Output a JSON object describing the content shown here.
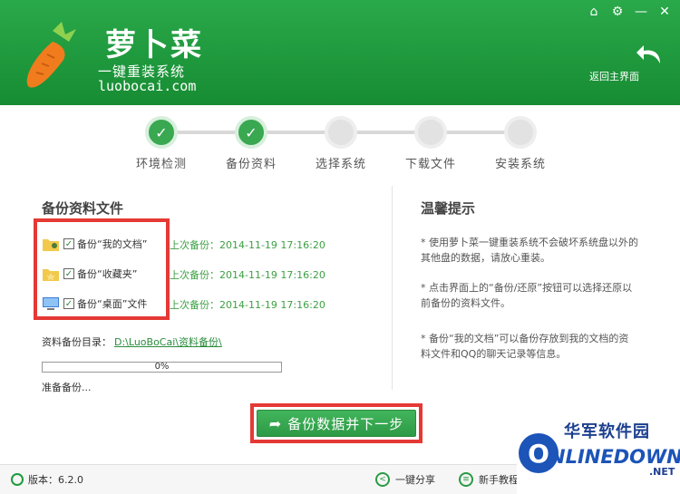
{
  "header": {
    "logo_title": "萝卜菜",
    "logo_subtitle": "一键重装系统",
    "logo_url": "luobocai.com",
    "back_label": "返回主界面",
    "window_buttons": [
      "home-icon",
      "gear-icon",
      "minimize-icon",
      "close-icon"
    ]
  },
  "steps": [
    {
      "label": "环境检测",
      "done": true
    },
    {
      "label": "备份资料",
      "done": true
    },
    {
      "label": "选择系统",
      "done": false
    },
    {
      "label": "下载文件",
      "done": false
    },
    {
      "label": "安装系统",
      "done": false
    }
  ],
  "backup": {
    "title": "备份资料文件",
    "items": [
      {
        "label": "备份“我的文档”",
        "time": "上次备份：2014-11-19 17:16:20",
        "checked": true
      },
      {
        "label": "备份“收藏夹”",
        "time": "上次备份：2014-11-19 17:16:20",
        "checked": true
      },
      {
        "label": "备份“桌面”文件",
        "time": "上次备份：2014-11-19 17:16:20",
        "checked": true
      }
    ],
    "dir_label": "资料备份目录：",
    "dir_path": "D:\\LuoBoCai\\资料备份\\",
    "progress": 0,
    "progress_text": "0%",
    "status": "准备备份..."
  },
  "tips": {
    "title": "温馨提示",
    "items": [
      "* 使用萝卜菜一键重装系统不会破坏系统盘以外的其他盘的数据，请放心重装。",
      "* 点击界面上的“备份/还原”按钮可以选择还原以前备份的资料文件。",
      "* 备份“我的文档”可以备份存放到我的文档的资料文件和QQ的聊天记录等信息。"
    ]
  },
  "next_button": "备份数据并下一步",
  "footer": {
    "version": "版本：6.2.0",
    "share": "一键分享",
    "tutorial": "新手教程"
  },
  "watermark": {
    "cn": "华军软件园",
    "en": "NLINEDOWN",
    "o": "O",
    "net": ".NET"
  },
  "colors": {
    "brand_green": "#1f9e3c",
    "highlight_red": "#e53935",
    "time_green": "#3da043"
  }
}
